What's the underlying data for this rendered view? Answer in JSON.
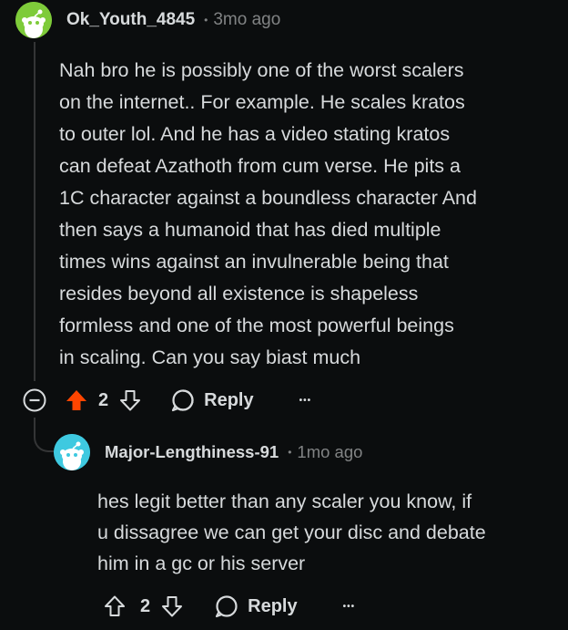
{
  "comments": [
    {
      "username": "Ok_Youth_4845",
      "separator": "•",
      "time": "3mo ago",
      "body": "Nah bro he is possibly one of the worst scalers\non the internet.. For example. He scales kratos\nto outer lol. And he has a video stating kratos\ncan defeat Azathoth from cum verse.  He pits a\n1C character against a boundless character And\nthen says a humanoid that has died multiple\ntimes wins against an invulnerable being that\nresides beyond all existence is shapeless\nformless and one of the most powerful beings\nin scaling. Can you say biast much",
      "votes": "2",
      "upvoted": true,
      "reply_label": "Reply",
      "more_label": "•••",
      "avatar_color": "#7ecb3a"
    },
    {
      "username": "Major-Lengthiness-91",
      "separator": "•",
      "time": "1mo ago",
      "body": "hes legit better than any scaler you know, if\nu dissagree we can get your disc and debate\nhim in a gc or his server",
      "votes": "2",
      "upvoted": false,
      "reply_label": "Reply",
      "more_label": "•••",
      "avatar_color": "#3ec9e0"
    }
  ],
  "colors": {
    "background": "#0b0d0e",
    "text": "#d7dadc",
    "muted": "#818384",
    "upvote_active": "#ff4500",
    "thread_line": "#343536"
  }
}
